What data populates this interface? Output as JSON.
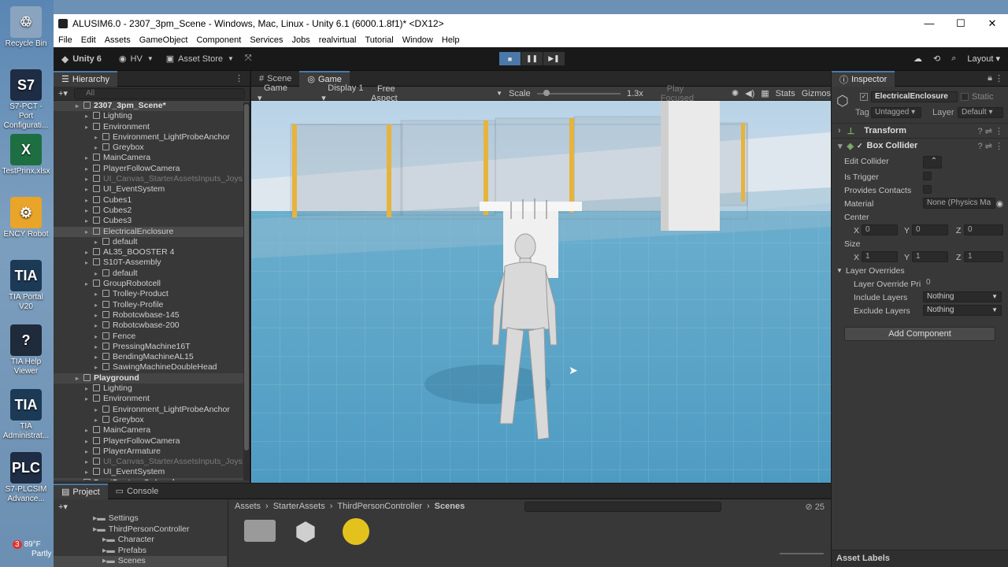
{
  "desktop": {
    "icons": [
      {
        "label": "Recycle Bin",
        "glyph": "♲",
        "color": "#8aa4c0"
      },
      {
        "label": "S7-PCT - Port Configurati...",
        "glyph": "S7",
        "color": "#1e2c44"
      },
      {
        "label": "TestPrinx.xlsx",
        "glyph": "X",
        "color": "#1d6f42"
      },
      {
        "label": "ENCY Robot",
        "glyph": "⚙",
        "color": "#e9a42a"
      },
      {
        "label": "TIA Portal V20",
        "glyph": "TIA",
        "color": "#1c3a56"
      },
      {
        "label": "TIA Help Viewer",
        "glyph": "?",
        "color": "#1f2a3a"
      },
      {
        "label": "TIA Administrat...",
        "glyph": "TIA",
        "color": "#1c3a56"
      },
      {
        "label": "S7-PLCSIM Advance...",
        "glyph": "PLC",
        "color": "#1e2c44"
      }
    ],
    "weather": {
      "temp": "89°F",
      "desc": "Partly",
      "badge": "3"
    }
  },
  "window": {
    "title": "ALUSIM6.0 - 2307_3pm_Scene - Windows, Mac, Linux - Unity 6.1 (6000.1.8f1)* <DX12>",
    "controls": [
      "—",
      "☐",
      "✕"
    ]
  },
  "menu": [
    "File",
    "Edit",
    "Assets",
    "GameObject",
    "Component",
    "Services",
    "Jobs",
    "realvirtual",
    "Tutorial",
    "Window",
    "Help"
  ],
  "toolbar": {
    "unity": "Unity 6",
    "account": "HV",
    "asset_store": "Asset Store",
    "layout": "Layout"
  },
  "hierarchy": {
    "tab": "Hierarchy",
    "search_placeholder": "All",
    "rows": [
      {
        "label": "2307_3pm_Scene*",
        "indent": 0,
        "type": "scene"
      },
      {
        "label": "Lighting",
        "indent": 1,
        "type": "node"
      },
      {
        "label": "Environment",
        "indent": 1,
        "type": "node"
      },
      {
        "label": "Environment_LightProbeAnchor",
        "indent": 2,
        "type": "node"
      },
      {
        "label": "Greybox",
        "indent": 2,
        "type": "node"
      },
      {
        "label": "MainCamera",
        "indent": 1,
        "type": "node"
      },
      {
        "label": "PlayerFollowCamera",
        "indent": 1,
        "type": "node"
      },
      {
        "label": "UI_Canvas_StarterAssetsInputs_Joys",
        "indent": 1,
        "type": "dim"
      },
      {
        "label": "UI_EventSystem",
        "indent": 1,
        "type": "node"
      },
      {
        "label": "Cubes1",
        "indent": 1,
        "type": "node"
      },
      {
        "label": "Cubes2",
        "indent": 1,
        "type": "node"
      },
      {
        "label": "Cubes3",
        "indent": 1,
        "type": "node"
      },
      {
        "label": "ElectricalEnclosure",
        "indent": 1,
        "type": "sel"
      },
      {
        "label": "default",
        "indent": 2,
        "type": "node"
      },
      {
        "label": "AL35_BOOSTER 4",
        "indent": 1,
        "type": "node"
      },
      {
        "label": "S10T-Assembly",
        "indent": 1,
        "type": "node"
      },
      {
        "label": "default",
        "indent": 2,
        "type": "node"
      },
      {
        "label": "GroupRobotcell",
        "indent": 1,
        "type": "node"
      },
      {
        "label": "Trolley-Product",
        "indent": 2,
        "type": "node"
      },
      {
        "label": "Trolley-Profile",
        "indent": 2,
        "type": "node"
      },
      {
        "label": "Robotcwbase-145",
        "indent": 2,
        "type": "node"
      },
      {
        "label": "Robotcwbase-200",
        "indent": 2,
        "type": "node"
      },
      {
        "label": "Fence",
        "indent": 2,
        "type": "node"
      },
      {
        "label": "PressingMachine16T",
        "indent": 2,
        "type": "node"
      },
      {
        "label": "BendingMachineAL15",
        "indent": 2,
        "type": "node"
      },
      {
        "label": "SawingMachineDoubleHead",
        "indent": 2,
        "type": "node"
      },
      {
        "label": "Playground",
        "indent": 0,
        "type": "scene"
      },
      {
        "label": "Lighting",
        "indent": 1,
        "type": "node"
      },
      {
        "label": "Environment",
        "indent": 1,
        "type": "node"
      },
      {
        "label": "Environment_LightProbeAnchor",
        "indent": 2,
        "type": "node"
      },
      {
        "label": "Greybox",
        "indent": 2,
        "type": "node"
      },
      {
        "label": "MainCamera",
        "indent": 1,
        "type": "node"
      },
      {
        "label": "PlayerFollowCamera",
        "indent": 1,
        "type": "node"
      },
      {
        "label": "PlayerArmature",
        "indent": 1,
        "type": "node"
      },
      {
        "label": "UI_Canvas_StarterAssetsInputs_Joys",
        "indent": 1,
        "type": "dim"
      },
      {
        "label": "UI_EventSystem",
        "indent": 1,
        "type": "node"
      },
      {
        "label": "DontDestroyOnLoad",
        "indent": 0,
        "type": "scene"
      }
    ]
  },
  "center": {
    "tabs": [
      "Scene",
      "Game"
    ],
    "game_toolbar": {
      "game": "Game",
      "display": "Display 1",
      "aspect": "Free Aspect",
      "scale_label": "Scale",
      "scale_value": "1.3x",
      "play_focused": "Play Focused",
      "stats": "Stats",
      "gizmos": "Gizmos"
    }
  },
  "inspector": {
    "tab": "Inspector",
    "object_name": "ElectricalEnclosure",
    "static_label": "Static",
    "tag_label": "Tag",
    "tag_value": "Untagged",
    "layer_label": "Layer",
    "layer_value": "Default",
    "transform": "Transform",
    "box_collider": "Box Collider",
    "edit_collider": "Edit Collider",
    "is_trigger": "Is Trigger",
    "provides_contacts": "Provides Contacts",
    "material_label": "Material",
    "material_value": "None (Physics Ma",
    "center_label": "Center",
    "center": {
      "x": "0",
      "y": "0",
      "z": "0"
    },
    "size_label": "Size",
    "size": {
      "x": "1",
      "y": "1",
      "z": "1"
    },
    "layer_overrides": "Layer Overrides",
    "layer_override_priority": "Layer Override Pri",
    "layer_override_priority_value": "0",
    "include_layers": "Include Layers",
    "include_value": "Nothing",
    "exclude_layers": "Exclude Layers",
    "exclude_value": "Nothing",
    "add_component": "Add Component",
    "asset_labels": "Asset Labels"
  },
  "project": {
    "tabs": [
      "Project",
      "Console"
    ],
    "tree": [
      {
        "label": "Settings",
        "indent": 1
      },
      {
        "label": "ThirdPersonController",
        "indent": 1
      },
      {
        "label": "Character",
        "indent": 2
      },
      {
        "label": "Prefabs",
        "indent": 2
      },
      {
        "label": "Scenes",
        "indent": 2
      }
    ],
    "breadcrumb": [
      "Assets",
      "StarterAssets",
      "ThirdPersonController",
      "Scenes"
    ],
    "count": "25"
  },
  "colors": {
    "accent": "#4a78a8",
    "panel": "#383838",
    "dark": "#191919"
  }
}
